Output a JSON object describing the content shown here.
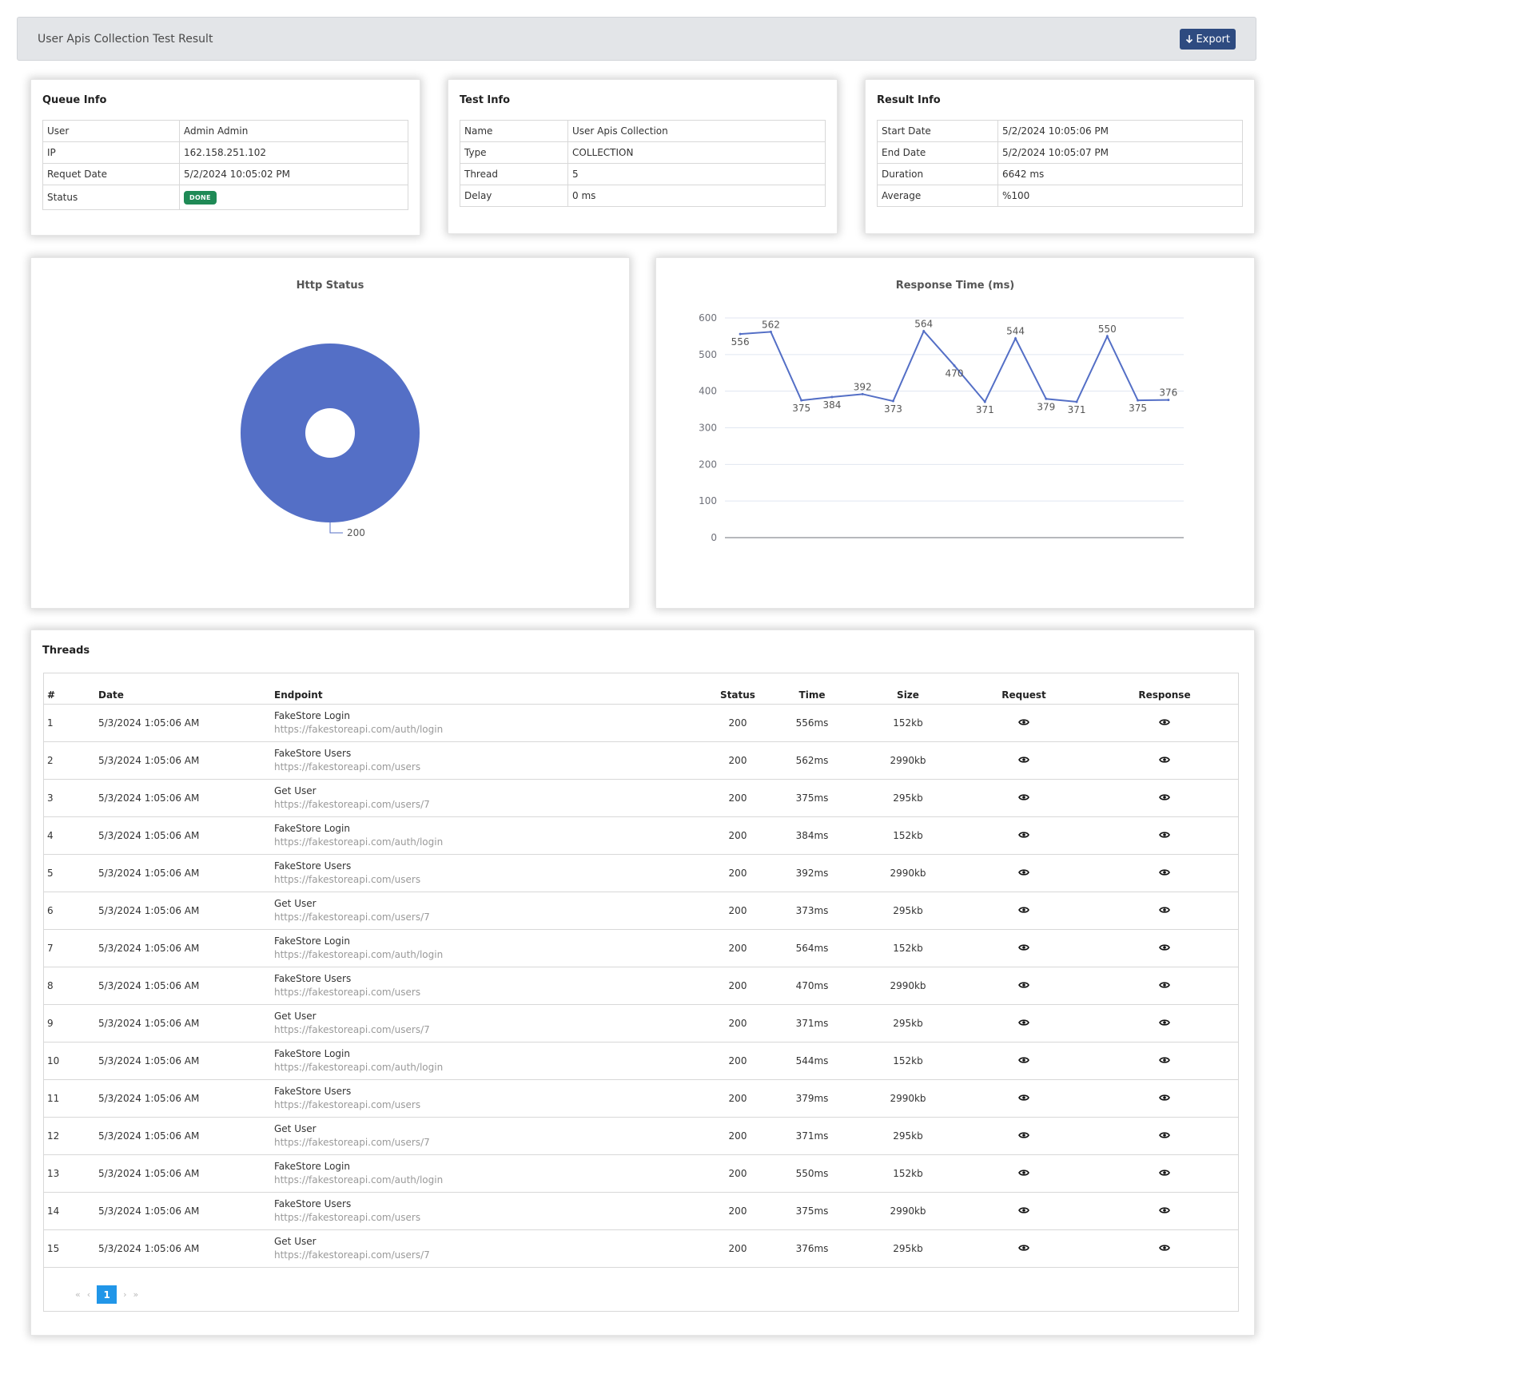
{
  "header": {
    "title": "User Apis Collection Test Result",
    "export_label": "Export"
  },
  "queue_info": {
    "title": "Queue Info",
    "rows": [
      {
        "label": "User",
        "value": "Admin Admin"
      },
      {
        "label": "IP",
        "value": "162.158.251.102"
      },
      {
        "label": "Requet Date",
        "value": "5/2/2024 10:05:02 PM"
      }
    ],
    "status_label": "Status",
    "status_value": "DONE",
    "status_color": "#1f8a56"
  },
  "test_info": {
    "title": "Test Info",
    "rows": [
      {
        "label": "Name",
        "value": "User Apis Collection"
      },
      {
        "label": "Type",
        "value": "COLLECTION"
      },
      {
        "label": "Thread",
        "value": "5"
      },
      {
        "label": "Delay",
        "value": "0 ms"
      }
    ]
  },
  "result_info": {
    "title": "Result Info",
    "rows": [
      {
        "label": "Start Date",
        "value": "5/2/2024 10:05:06 PM"
      },
      {
        "label": "End Date",
        "value": "5/2/2024 10:05:07 PM"
      },
      {
        "label": "Duration",
        "value": "6642 ms"
      },
      {
        "label": "Average",
        "value": "%100"
      }
    ]
  },
  "chart_data": [
    {
      "type": "pie",
      "title": "Http Status",
      "categories": [
        "200"
      ],
      "values": [
        15
      ],
      "color": "#546fc6"
    },
    {
      "type": "line",
      "title": "Response Time (ms)",
      "x": [
        1,
        2,
        3,
        4,
        5,
        6,
        7,
        8,
        9,
        10,
        11,
        12,
        13,
        14,
        15
      ],
      "values": [
        556,
        562,
        375,
        384,
        392,
        373,
        564,
        470,
        371,
        544,
        379,
        371,
        550,
        375,
        376
      ],
      "ylim": [
        0,
        600
      ],
      "yticks": [
        0,
        100,
        200,
        300,
        400,
        500,
        600
      ],
      "grid": true,
      "color": "#546fc6"
    }
  ],
  "threads": {
    "title": "Threads",
    "columns": [
      "#",
      "Date",
      "Endpoint",
      "Status",
      "Time",
      "Size",
      "Request",
      "Response"
    ],
    "rows": [
      {
        "num": "1",
        "date": "5/3/2024 1:05:06 AM",
        "name": "FakeStore Login",
        "url": "https://fakestoreapi.com/auth/login",
        "status": "200",
        "time": "556ms",
        "size": "152kb"
      },
      {
        "num": "2",
        "date": "5/3/2024 1:05:06 AM",
        "name": "FakeStore Users",
        "url": "https://fakestoreapi.com/users",
        "status": "200",
        "time": "562ms",
        "size": "2990kb"
      },
      {
        "num": "3",
        "date": "5/3/2024 1:05:06 AM",
        "name": "Get User",
        "url": "https://fakestoreapi.com/users/7",
        "status": "200",
        "time": "375ms",
        "size": "295kb"
      },
      {
        "num": "4",
        "date": "5/3/2024 1:05:06 AM",
        "name": "FakeStore Login",
        "url": "https://fakestoreapi.com/auth/login",
        "status": "200",
        "time": "384ms",
        "size": "152kb"
      },
      {
        "num": "5",
        "date": "5/3/2024 1:05:06 AM",
        "name": "FakeStore Users",
        "url": "https://fakestoreapi.com/users",
        "status": "200",
        "time": "392ms",
        "size": "2990kb"
      },
      {
        "num": "6",
        "date": "5/3/2024 1:05:06 AM",
        "name": "Get User",
        "url": "https://fakestoreapi.com/users/7",
        "status": "200",
        "time": "373ms",
        "size": "295kb"
      },
      {
        "num": "7",
        "date": "5/3/2024 1:05:06 AM",
        "name": "FakeStore Login",
        "url": "https://fakestoreapi.com/auth/login",
        "status": "200",
        "time": "564ms",
        "size": "152kb"
      },
      {
        "num": "8",
        "date": "5/3/2024 1:05:06 AM",
        "name": "FakeStore Users",
        "url": "https://fakestoreapi.com/users",
        "status": "200",
        "time": "470ms",
        "size": "2990kb"
      },
      {
        "num": "9",
        "date": "5/3/2024 1:05:06 AM",
        "name": "Get User",
        "url": "https://fakestoreapi.com/users/7",
        "status": "200",
        "time": "371ms",
        "size": "295kb"
      },
      {
        "num": "10",
        "date": "5/3/2024 1:05:06 AM",
        "name": "FakeStore Login",
        "url": "https://fakestoreapi.com/auth/login",
        "status": "200",
        "time": "544ms",
        "size": "152kb"
      },
      {
        "num": "11",
        "date": "5/3/2024 1:05:06 AM",
        "name": "FakeStore Users",
        "url": "https://fakestoreapi.com/users",
        "status": "200",
        "time": "379ms",
        "size": "2990kb"
      },
      {
        "num": "12",
        "date": "5/3/2024 1:05:06 AM",
        "name": "Get User",
        "url": "https://fakestoreapi.com/users/7",
        "status": "200",
        "time": "371ms",
        "size": "295kb"
      },
      {
        "num": "13",
        "date": "5/3/2024 1:05:06 AM",
        "name": "FakeStore Login",
        "url": "https://fakestoreapi.com/auth/login",
        "status": "200",
        "time": "550ms",
        "size": "152kb"
      },
      {
        "num": "14",
        "date": "5/3/2024 1:05:06 AM",
        "name": "FakeStore Users",
        "url": "https://fakestoreapi.com/users",
        "status": "200",
        "time": "375ms",
        "size": "2990kb"
      },
      {
        "num": "15",
        "date": "5/3/2024 1:05:06 AM",
        "name": "Get User",
        "url": "https://fakestoreapi.com/users/7",
        "status": "200",
        "time": "376ms",
        "size": "295kb"
      }
    ],
    "pagination": {
      "first": "«",
      "prev": "‹",
      "current": "1",
      "next": "›",
      "last": "»"
    }
  }
}
